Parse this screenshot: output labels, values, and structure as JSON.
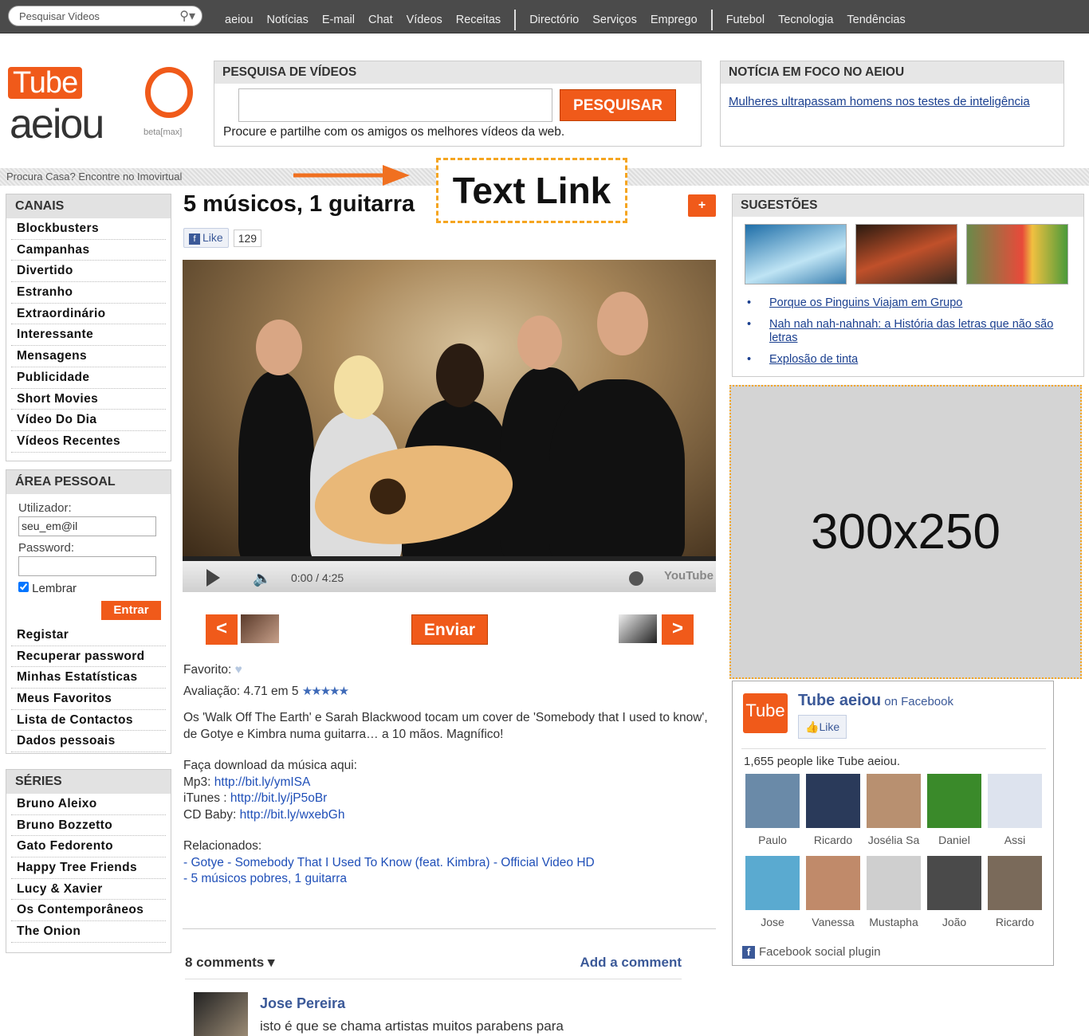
{
  "topbar": {
    "search_placeholder": "Pesquisar Videos",
    "nav1": [
      "aeiou",
      "Notícias",
      "E-mail",
      "Chat",
      "Vídeos",
      "Receitas"
    ],
    "nav2": [
      "Directório",
      "Serviços",
      "Emprego"
    ],
    "nav3": [
      "Futebol",
      "Tecnologia",
      "Tendências"
    ]
  },
  "logo": {
    "tube": "Tube",
    "aeiou": "aeiou",
    "beta": "beta[max]"
  },
  "video_search": {
    "header": "PESQUISA DE VÍDEOS",
    "button": "PESQUISAR",
    "description": "Procure e partilhe com os amigos os melhores vídeos da web."
  },
  "news": {
    "header": "NOTÍCIA EM FOCO NO AEIOU",
    "link": "Mulheres ultrapassam homens nos testes de inteligência"
  },
  "strip": {
    "text": "Procura Casa? Encontre no Imovirtual"
  },
  "annotation": {
    "text_link": "Text Link"
  },
  "canais": {
    "header": "CANAIS",
    "items": [
      "Blockbusters",
      "Campanhas",
      "Divertido",
      "Estranho",
      "Extraordinário",
      "Interessante",
      "Mensagens",
      "Publicidade",
      "Short Movies",
      "Vídeo Do Dia",
      "Vídeos Recentes"
    ]
  },
  "area": {
    "header": "ÁREA PESSOAL",
    "user_label": "Utilizador:",
    "user_value": "seu_em@il",
    "password_label": "Password:",
    "remember": "Lembrar",
    "login": "Entrar",
    "items": [
      "Registar",
      "Recuperar password",
      "Minhas Estatísticas",
      "Meus Favoritos",
      "Lista de Contactos",
      "Dados pessoais"
    ]
  },
  "series": {
    "header": "SÉRIES",
    "items": [
      "Bruno Aleixo",
      "Bruno Bozzetto",
      "Gato Fedorento",
      "Happy Tree Friends",
      "Lucy & Xavier",
      "Os Contemporâneos",
      "The Onion"
    ]
  },
  "video": {
    "title": "5 músicos, 1 guitarra",
    "plus": "+",
    "like": "Like",
    "like_count": "129",
    "time": "0:00 / 4:25",
    "youtube": "YouTube",
    "prev": "<",
    "next": ">",
    "send": "Enviar",
    "favorite_label": "Favorito:",
    "rating": "Avaliação: 4.71 em 5",
    "rating_value": 4.71,
    "description": "Os 'Walk Off The Earth' e Sarah Blackwood tocam um cover de 'Somebody that I used to know', de Gotye e Kimbra numa guitarra… a 10 mãos. Magnífico!",
    "download_title": "Faça download da música aqui:",
    "mp3_label": "Mp3: ",
    "mp3_link": "http://bit.ly/ymISA",
    "itunes_label": "iTunes : ",
    "itunes_link": "http://bit.ly/jP5oBr",
    "cdbaby_label": "CD Baby: ",
    "cdbaby_link": "http://bit.ly/wxebGh",
    "related_title": "Relacionados:",
    "related": [
      "- Gotye - Somebody That I Used To Know (feat. Kimbra) - Official Video HD",
      "- 5 músicos pobres, 1 guitarra"
    ]
  },
  "comments": {
    "count": "8 comments ▾",
    "add": "Add a comment",
    "author": "Jose Pereira",
    "text": "isto é que se chama artistas muitos parabens para"
  },
  "suggestions": {
    "header": "SUGESTÕES",
    "links": [
      "Porque os Pinguins Viajam em Grupo",
      "Nah nah nah-nahnah: a História das letras que não são letras",
      "Explosão de tinta"
    ]
  },
  "ad": {
    "label": "300x250"
  },
  "facebook": {
    "logo": "Tube",
    "title": "Tube aeiou",
    "on": " on Facebook",
    "like": "Like",
    "count_text": "1,655 people like Tube aeiou.",
    "faces": [
      "Paulo",
      "Ricardo",
      "Josélia Sa",
      "Daniel",
      "Assi",
      "Jose",
      "Vanessa",
      "Mustapha",
      "João",
      "Ricardo"
    ],
    "footer": "Facebook social plugin"
  }
}
